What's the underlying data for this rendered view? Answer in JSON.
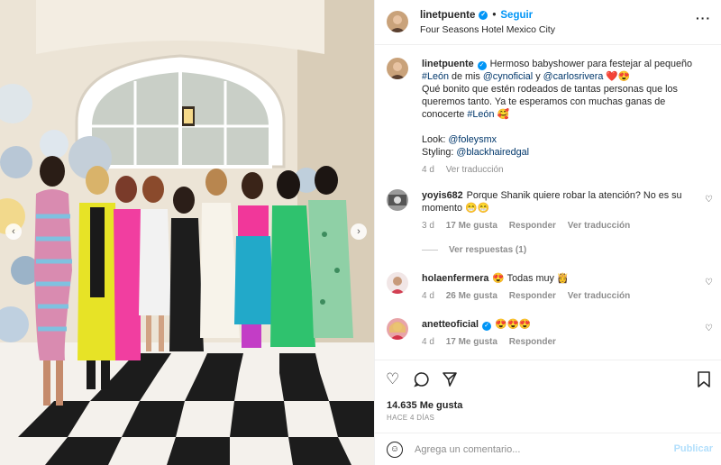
{
  "post": {
    "username": "linetpuente",
    "follow_label": "Seguir",
    "location": "Four Seasons Hotel Mexico City",
    "more_icon": "more-options-icon"
  },
  "caption": {
    "username": "linetpuente",
    "line1": "Hermoso babyshower para festejar al pequeño",
    "tag_leon": "#León",
    "text_de_mis": " de mis ",
    "mention_cyno": "@cynoficial",
    "text_y": " y ",
    "mention_carlos": "@carlosrivera",
    "emoji1": " ❤️😍",
    "line2": "Qué bonito que estén rodeados de tantas personas que los queremos tanto. Ya te esperamos con muchas ganas de conocerte ",
    "tag_leon2": "#León",
    "emoji2": " 🥰",
    "look_label": "Look: ",
    "look_mention": "@foleysmx",
    "styling_label": "Styling: ",
    "styling_mention": "@blackhairedgal",
    "time": "4 d",
    "translate": "Ver traducción"
  },
  "comments": [
    {
      "username": "yoyis682",
      "text": "Porque Shanik quiere robar la atención? No es su momento 😁😁",
      "time": "3 d",
      "likes": "17 Me gusta",
      "reply": "Responder",
      "translate": "Ver traducción",
      "view_replies": "Ver respuestas (1)"
    },
    {
      "username": "holaenfermera",
      "text": "😍 Todas muy 👸",
      "time": "4 d",
      "likes": "26 Me gusta",
      "reply": "Responder",
      "translate": "Ver traducción"
    },
    {
      "username": "anetteoficial",
      "text": "😍😍😍",
      "time": "4 d",
      "likes": "17 Me gusta",
      "reply": "Responder"
    }
  ],
  "actions": {
    "likes": "14.635 Me gusta",
    "ago": "HACE 4 DÍAS"
  },
  "composer": {
    "placeholder": "Agrega un comentario...",
    "post_label": "Publicar"
  },
  "colors": {
    "accent": "#0095f6",
    "link": "#00376b",
    "muted": "#8e8e8e",
    "like_heart": "#ed4956"
  }
}
